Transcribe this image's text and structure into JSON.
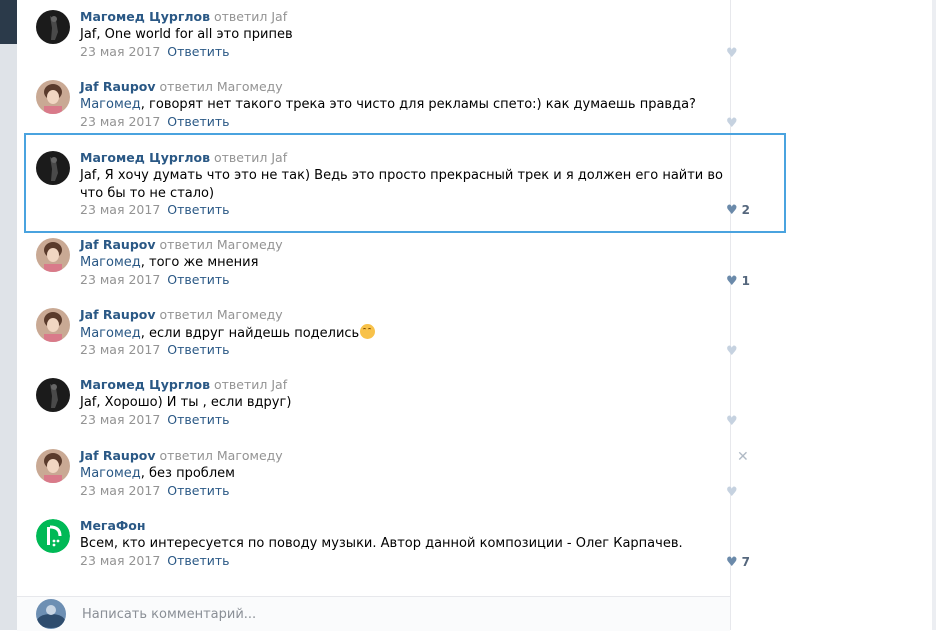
{
  "comments": [
    {
      "author": "Магомед Цурглов",
      "reply_to": "ответил Jaf",
      "mention": "Jaf",
      "text": ", One world for all это припев",
      "date": "23 мая 2017",
      "reply_label": "Ответить",
      "likes": ""
    },
    {
      "author": "Jaf Raupov",
      "reply_to": "ответил Магомеду",
      "mention": "Магомед",
      "text": ", говорят нет такого трека это чисто для рекламы спето:) как думаешь правда?",
      "date": "23 мая 2017",
      "reply_label": "Ответить",
      "likes": ""
    },
    {
      "author": "Магомед Цурглов",
      "reply_to": "ответил Jaf",
      "mention": "Jaf",
      "text": ", Я хочу думать что это не так) Ведь это просто прекрасный трек и я должен его найти во что бы то не стало)",
      "date": "23 мая 2017",
      "reply_label": "Ответить",
      "likes": "2"
    },
    {
      "author": "Jaf Raupov",
      "reply_to": "ответил Магомеду",
      "mention": "Магомед",
      "text": ", того же мнения",
      "date": "23 мая 2017",
      "reply_label": "Ответить",
      "likes": "1"
    },
    {
      "author": "Jaf Raupov",
      "reply_to": "ответил Магомеду",
      "mention": "Магомед",
      "text": ", если вдруг найдешь поделись",
      "date": "23 мая 2017",
      "reply_label": "Ответить",
      "likes": ""
    },
    {
      "author": "Магомед Цурглов",
      "reply_to": "ответил Jaf",
      "mention": "Jaf",
      "text": ", Хорошо) И ты , если вдруг)",
      "date": "23 мая 2017",
      "reply_label": "Ответить",
      "likes": ""
    },
    {
      "author": "Jaf Raupov",
      "reply_to": "ответил Магомеду",
      "mention": "Магомед",
      "text": ", без проблем",
      "date": "23 мая 2017",
      "reply_label": "Ответить",
      "likes": ""
    },
    {
      "author": "МегаФон",
      "reply_to": "",
      "mention": "",
      "text": "Всем, кто интересуется по поводу музыки. Автор данной композиции - Олег Карпачев.",
      "date": "23 мая 2017",
      "reply_label": "Ответить",
      "likes": "7"
    }
  ],
  "composer": {
    "placeholder": "Написать комментарий..."
  },
  "icons": {
    "like": "heart-icon",
    "delete": "close-icon",
    "emoji": "smile-emoji-icon"
  },
  "colors": {
    "link": "#2a5885",
    "muted": "#939393",
    "highlight": "#4aa3df",
    "megafon": "#00b956"
  }
}
